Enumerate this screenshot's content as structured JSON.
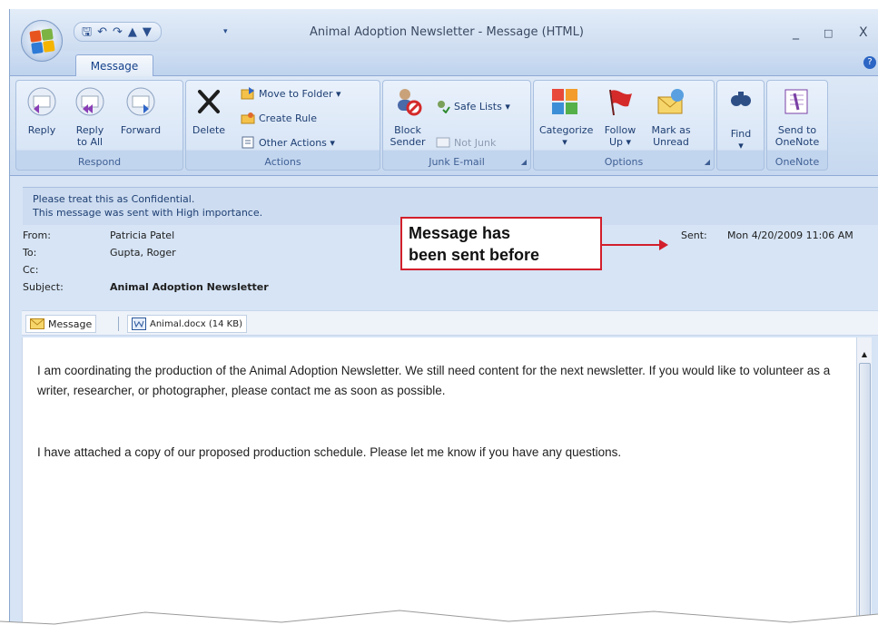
{
  "window": {
    "title": "Animal Adoption Newsletter - Message (HTML)",
    "minimize": "_",
    "maximize": "□",
    "close": "X"
  },
  "qat": {
    "more": "▾"
  },
  "tabs": {
    "message": "Message"
  },
  "ribbon": {
    "respond": {
      "label": "Respond",
      "reply": "Reply",
      "reply_all_1": "Reply",
      "reply_all_2": "to All",
      "forward": "Forward"
    },
    "actions": {
      "label": "Actions",
      "delete": "Delete",
      "move_to_folder": "Move to Folder ▾",
      "create_rule": "Create Rule",
      "other_actions": "Other Actions ▾"
    },
    "junk": {
      "label": "Junk E-mail",
      "block_1": "Block",
      "block_2": "Sender",
      "safe_lists": "Safe Lists ▾",
      "not_junk": "Not Junk"
    },
    "options": {
      "label": "Options",
      "categorize_1": "Categorize",
      "categorize_2": "▾",
      "follow_1": "Follow",
      "follow_2": "Up ▾",
      "mark_1": "Mark as",
      "mark_2": "Unread"
    },
    "find": {
      "label_1": "Find",
      "label_2": "▾"
    },
    "onenote": {
      "label": "OneNote",
      "send_1": "Send to",
      "send_2": "OneNote"
    }
  },
  "header": {
    "info_line_1": "Please treat this as Confidential.",
    "info_line_2": "This message was sent with High importance.",
    "from_label": "From:",
    "from": "Patricia Patel",
    "to_label": "To:",
    "to": "Gupta, Roger",
    "cc_label": "Cc:",
    "cc": "",
    "subject_label": "Subject:",
    "subject": "Animal Adoption Newsletter",
    "sent_label": "Sent:",
    "sent": "Mon 4/20/2009 11:06 AM"
  },
  "attachments": {
    "message_tab": "Message",
    "file": "Animal.docx (14 KB)"
  },
  "body": {
    "paragraph_1": "I am coordinating the production of the Animal Adoption Newsletter. We still need content for the next newsletter. If you would like to volunteer as a writer, researcher, or photographer, please contact me as soon as possible.",
    "paragraph_2": "I have attached a copy of our proposed production schedule. Please let me know if you have any questions."
  },
  "callout": {
    "line_1": "Message has",
    "line_2": "been sent before"
  },
  "colors": {
    "accent": "#15428b",
    "ribbon": "#c6d8ef",
    "callout_border": "#d31f2c",
    "flag": "#d42a2a"
  },
  "icons": [
    "office-button-icon",
    "save-icon",
    "undo-icon",
    "redo-icon",
    "previous-item-icon",
    "next-item-icon",
    "reply-icon",
    "reply-all-icon",
    "forward-icon",
    "delete-icon",
    "move-to-folder-icon",
    "create-rule-icon",
    "other-actions-icon",
    "block-sender-icon",
    "safe-lists-icon",
    "not-junk-icon",
    "categorize-icon",
    "follow-up-flag-icon",
    "mark-unread-icon",
    "find-icon",
    "onenote-icon",
    "envelope-icon",
    "word-document-icon",
    "help-icon"
  ]
}
